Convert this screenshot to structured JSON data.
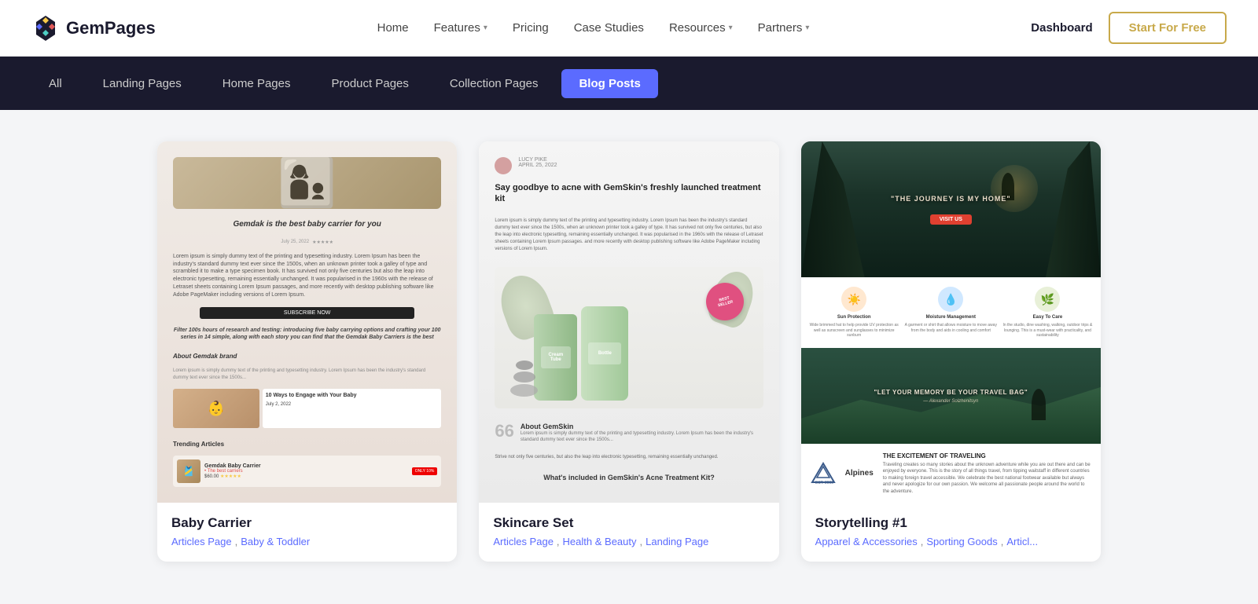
{
  "logo": {
    "text": "GemPages"
  },
  "nav": {
    "links": [
      {
        "label": "Home",
        "hasDropdown": false
      },
      {
        "label": "Features",
        "hasDropdown": true
      },
      {
        "label": "Pricing",
        "hasDropdown": false
      },
      {
        "label": "Case Studies",
        "hasDropdown": false
      },
      {
        "label": "Resources",
        "hasDropdown": true
      },
      {
        "label": "Partners",
        "hasDropdown": true
      }
    ],
    "dashboard": "Dashboard",
    "start": "Start For Free"
  },
  "filters": [
    {
      "label": "All",
      "active": false
    },
    {
      "label": "Landing Pages",
      "active": false
    },
    {
      "label": "Home Pages",
      "active": false
    },
    {
      "label": "Product Pages",
      "active": false
    },
    {
      "label": "Collection Pages",
      "active": false
    },
    {
      "label": "Blog Posts",
      "active": true
    }
  ],
  "cards": [
    {
      "id": "baby-carrier",
      "title": "Baby Carrier",
      "tags": [
        "Articles Page",
        "Baby & Toddler"
      ]
    },
    {
      "id": "skincare-set",
      "title": "Skincare Set",
      "tags": [
        "Articles Page",
        "Health & Beauty",
        "Landing Page"
      ]
    },
    {
      "id": "storytelling",
      "title": "Storytelling #1",
      "tags": [
        "Apparel & Accessories",
        "Sporting Goods",
        "Articl..."
      ]
    }
  ]
}
